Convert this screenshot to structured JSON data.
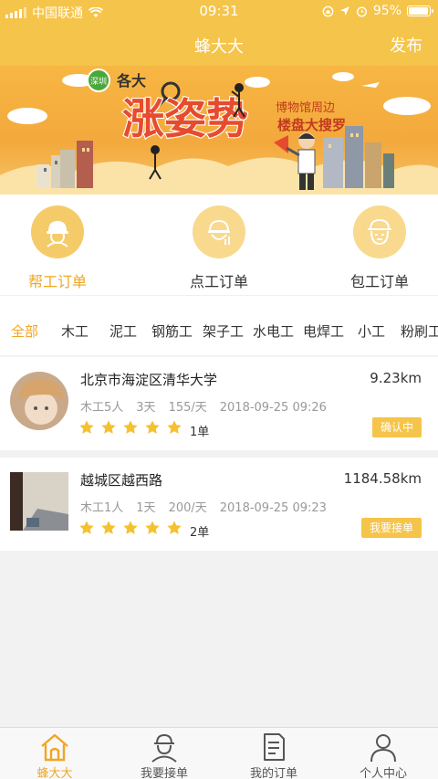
{
  "status_bar": {
    "carrier": "中国联通",
    "time": "09:31",
    "battery": "95%",
    "battery_level": 0.95
  },
  "navbar": {
    "title": "蜂大大",
    "publish_label": "发布"
  },
  "banner": {
    "logo": "深圳",
    "prefix": "各大",
    "headline": "涨姿势",
    "slogan_line1": "博物馆周边",
    "slogan_line2": "楼盘大搜罗"
  },
  "categories": [
    {
      "label": "帮工订单",
      "icon": "worker-helmet-icon",
      "active": true
    },
    {
      "label": "点工订单",
      "icon": "helmet-chart-icon",
      "active": false
    },
    {
      "label": "包工订单",
      "icon": "worker-face-icon",
      "active": false
    }
  ],
  "filters": [
    "全部",
    "木工",
    "泥工",
    "钢筋工",
    "架子工",
    "水电工",
    "电焊工",
    "小工",
    "粉刷工"
  ],
  "orders": [
    {
      "address": "北京市海淀区清华大学",
      "distance": "9.23km",
      "trade": "木工5人",
      "days": "3天",
      "price": "155/天",
      "datetime": "2018-09-25 09:26",
      "rating": 5,
      "count": "1单",
      "action": "确认中"
    },
    {
      "address": "越城区越西路",
      "distance": "1184.58km",
      "trade": "木工1人",
      "days": "1天",
      "price": "200/天",
      "datetime": "2018-09-25 09:23",
      "rating": 5,
      "count": "2单",
      "action": "我要接单"
    }
  ],
  "tabbar": [
    {
      "label": "蜂大大",
      "icon": "home-icon",
      "active": true
    },
    {
      "label": "我要接单",
      "icon": "worker-icon",
      "active": false
    },
    {
      "label": "我的订单",
      "icon": "document-icon",
      "active": false
    },
    {
      "label": "个人中心",
      "icon": "person-icon",
      "active": false
    }
  ],
  "colors": {
    "primary": "#f5c44a",
    "accent_text": "#f0a623",
    "background": "#f2f2f2"
  }
}
